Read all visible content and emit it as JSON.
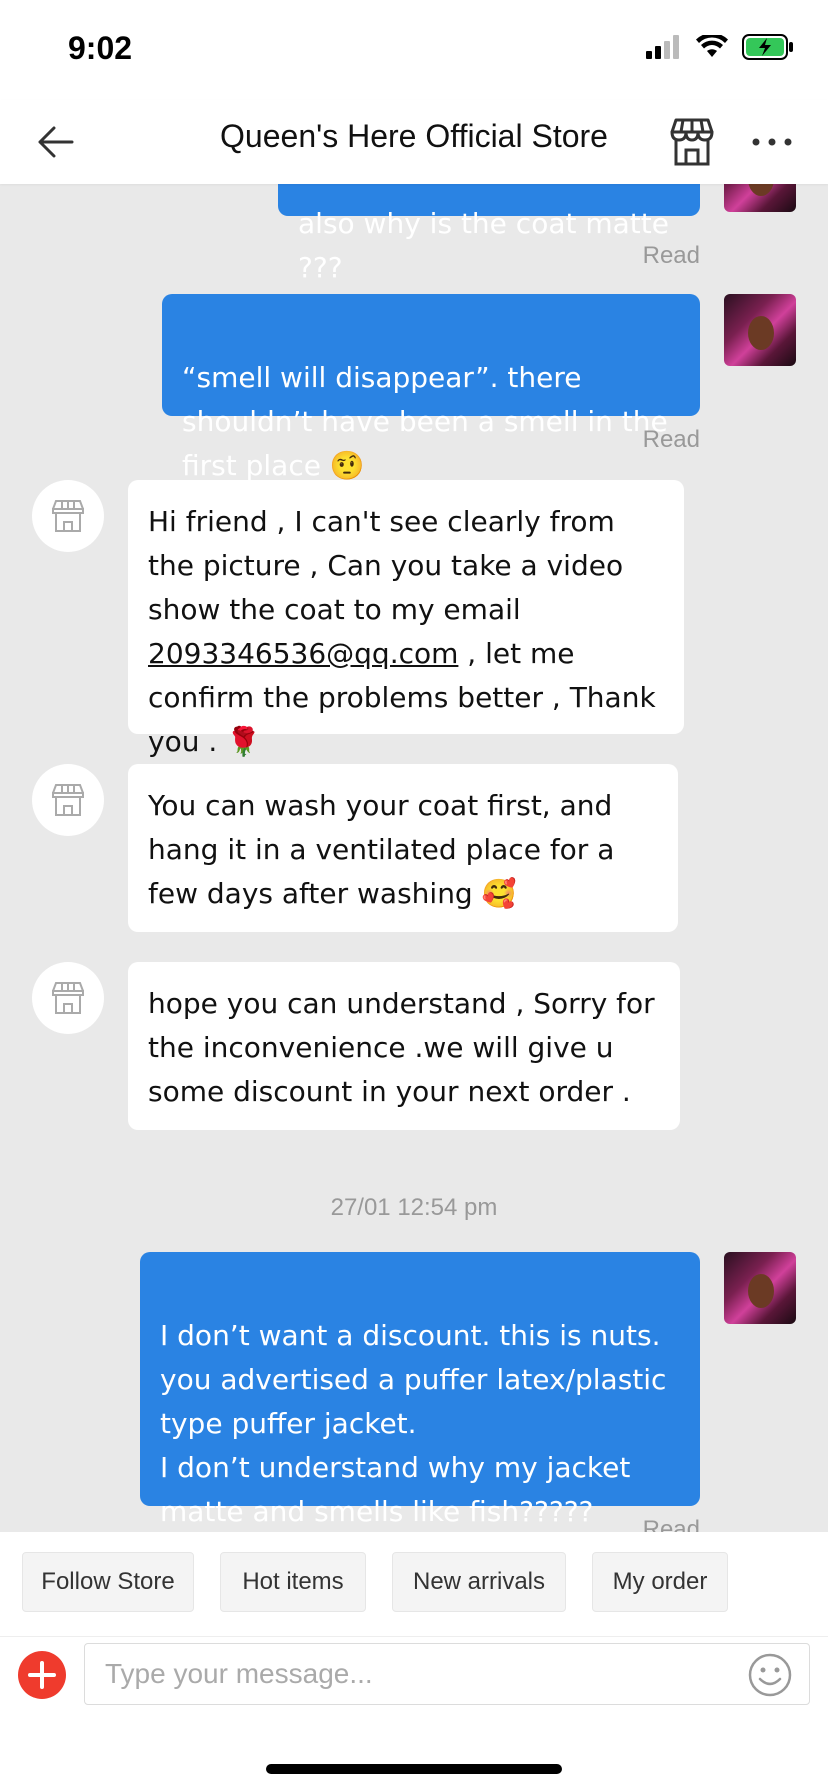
{
  "status_bar": {
    "time": "9:02",
    "battery_color": "#34c759"
  },
  "header": {
    "title": "Queen's Here Official Store"
  },
  "messages": [
    {
      "side": "out",
      "text": "also why is the coat matte ???",
      "status": "Read"
    },
    {
      "side": "out",
      "text": "“smell will disappear”. there shouldn’t have been a smell in the first place 🤨",
      "status": "Read"
    },
    {
      "side": "in",
      "text_before": "Hi friend , I can't see clearly from the picture , Can you take a video show the coat to my email ",
      "email": "2093346536@qq.com",
      "text_after": " , let me confirm the problems better , Thank you . 🌹"
    },
    {
      "side": "in",
      "text": "You can wash your coat first, and hang it in a ventilated place for a few days after washing 🥰"
    },
    {
      "side": "in",
      "text": "hope you can understand , Sorry for the inconvenience .we will give u some discount in your next order ."
    },
    {
      "timestamp": "27/01 12:54 pm"
    },
    {
      "side": "out",
      "text": "I don’t want a discount. this is nuts. you advertised a puffer latex/plastic type puffer jacket.\nI don’t understand why my jacket matte and smells like fish?????",
      "status": "Read"
    }
  ],
  "quick_actions": [
    "Follow Store",
    "Hot items",
    "New arrivals",
    "My order"
  ],
  "composer": {
    "placeholder": "Type your message..."
  },
  "colors": {
    "outgoing_bubble": "#2a83e3",
    "incoming_bubble": "#ffffff",
    "chat_background": "#e9e9e9",
    "plus_button": "#ef3b2d"
  }
}
